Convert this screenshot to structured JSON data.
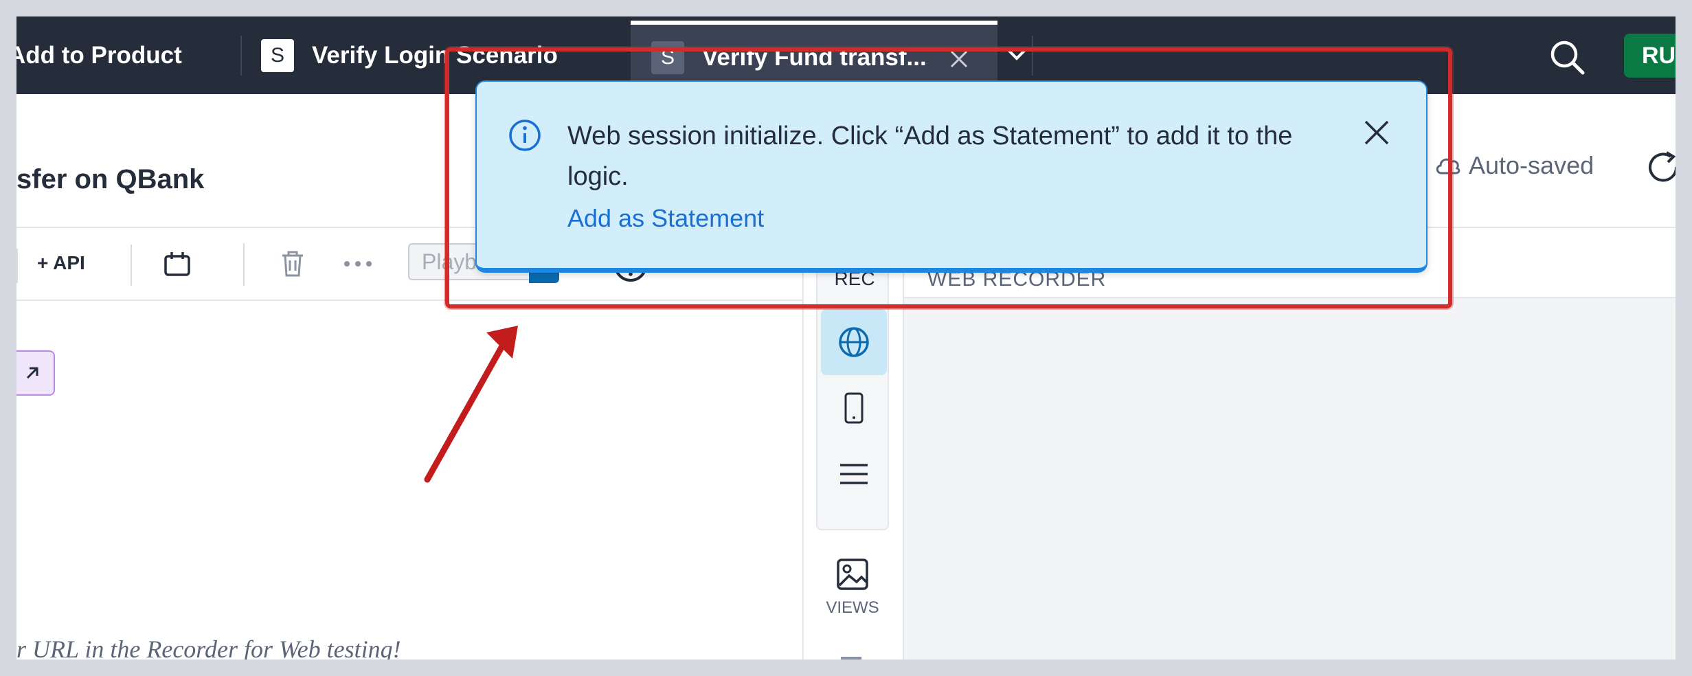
{
  "tabs": [
    {
      "label": "Add to Product"
    },
    {
      "label": "Verify Login Scenario",
      "badge": "S"
    },
    {
      "label": "Verify Fund transf...",
      "badge": "S",
      "active": true
    }
  ],
  "run_button": {
    "label": "RU"
  },
  "header": {
    "title": "sfer on QBank",
    "status": "Auto-saved"
  },
  "toolbar": {
    "api_label": "+ API",
    "playback_placeholder": "Playback"
  },
  "canvas": {
    "hint": "r URL in the Recorder for Web testing!"
  },
  "rail": {
    "rec_label": "REC",
    "views_label": "VIEWS"
  },
  "recorder": {
    "label": "WEB RECORDER"
  },
  "toast": {
    "message": "Web session initialize. Click “Add as Statement” to add it to the logic.",
    "action": "Add as Statement"
  },
  "colors": {
    "tabbar": "#252d3b",
    "annotation": "#d22b2b",
    "toast_bg": "#d2eefb",
    "link": "#1a6fd6",
    "run": "#0a7a45"
  },
  "icons": [
    "search-icon",
    "close-icon",
    "chevron-down-icon",
    "calendar-icon",
    "trash-icon",
    "more-icon",
    "help-icon",
    "globe-icon",
    "mobile-icon",
    "menu-icon",
    "image-icon",
    "info-icon",
    "cloud-icon",
    "refresh-icon",
    "external-link-icon"
  ]
}
